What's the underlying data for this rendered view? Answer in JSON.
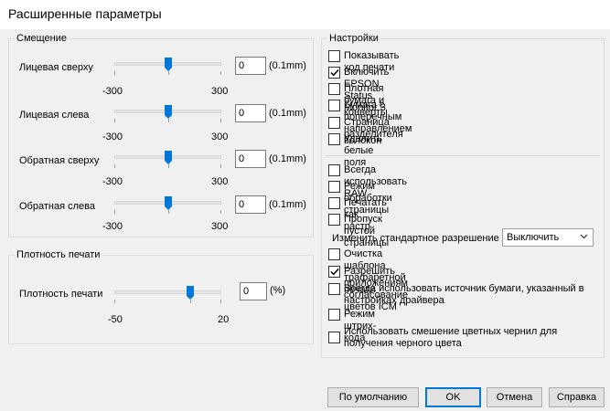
{
  "window": {
    "title": "Расширенные параметры"
  },
  "offset": {
    "group_label": "Смещение",
    "unit": "(0.1mm)",
    "rows": [
      {
        "label": "Лицевая сверху",
        "value": "0",
        "min": "-300",
        "max": "300",
        "level": 0.5
      },
      {
        "label": "Лицевая слева",
        "value": "0",
        "min": "-300",
        "max": "300",
        "level": 0.5
      },
      {
        "label": "Обратная сверху",
        "value": "0",
        "min": "-300",
        "max": "300",
        "level": 0.5
      },
      {
        "label": "Обратная слева",
        "value": "0",
        "min": "-300",
        "max": "300",
        "level": 0.5
      }
    ]
  },
  "density": {
    "group_label": "Плотность печати",
    "label": "Плотность печати",
    "value": "0",
    "unit": "(%)",
    "min": "-50",
    "max": "20",
    "level": 0.714
  },
  "settings": {
    "group_label": "Настройки",
    "checkboxes_a": [
      {
        "label": "Показывать ход печати",
        "checked": false
      },
      {
        "label": "Включить EPSON Status Monitor 3",
        "checked": true
      },
      {
        "label": "Плотная бумага и конверты",
        "checked": false
      },
      {
        "label": "Бумага с поперечным направлением волокон",
        "checked": false
      },
      {
        "label": "Страница разделителя",
        "checked": false
      },
      {
        "label": "Удалить белые поля",
        "checked": false
      }
    ],
    "checkboxes_b": [
      {
        "label": "Всегда использовать RAW",
        "checked": false
      },
      {
        "label": "Режим обработки страницы",
        "checked": false
      },
      {
        "label": "Печатать как растр",
        "checked": false
      },
      {
        "label": "Пропуск пустой страницы",
        "checked": false
      }
    ],
    "resolution_label": "Изменить стандартное разрешение",
    "resolution_value": "Выключить",
    "checkboxes_c": [
      {
        "label": "Очистка шаблона трафаретной печати",
        "checked": false
      },
      {
        "label": "Разрешить приложениям согласование цветов ICM",
        "checked": true
      },
      {
        "label": "Всегда использовать источник бумаги, указанный в настройках драйвера",
        "checked": false
      },
      {
        "label": "Режим штрих-кода",
        "checked": false
      },
      {
        "label": "Использовать смешение цветных чернил для получения черного цвета",
        "checked": false
      }
    ]
  },
  "buttons": {
    "defaults": "По умолчанию",
    "ok": "OK",
    "cancel": "Отмена",
    "help": "Справка"
  },
  "colors": {
    "accent": "#0078d7",
    "background": "#f0f0f0"
  }
}
